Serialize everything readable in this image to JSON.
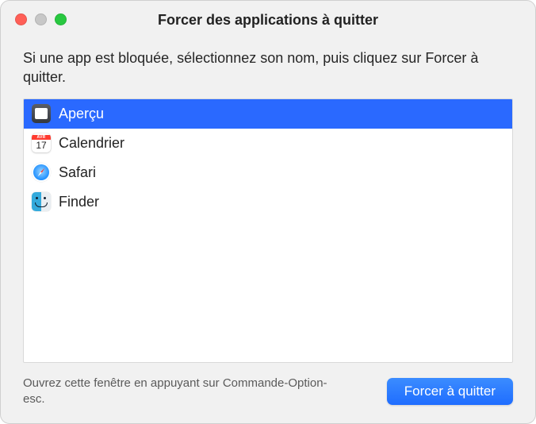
{
  "window": {
    "title": "Forcer des applications à quitter"
  },
  "instructions": "Si une app est bloquée, sélectionnez son nom, puis cliquez sur Forcer à quitter.",
  "apps": [
    {
      "name": "Aperçu",
      "icon": "preview",
      "selected": true
    },
    {
      "name": "Calendrier",
      "icon": "calendar",
      "selected": false
    },
    {
      "name": "Safari",
      "icon": "safari",
      "selected": false
    },
    {
      "name": "Finder",
      "icon": "finder",
      "selected": false
    }
  ],
  "calendar_icon": {
    "month": "AVR",
    "day": "17"
  },
  "footer": {
    "hint": "Ouvrez cette fenêtre en appuyant sur Commande-Option-esc.",
    "button": "Forcer à quitter"
  }
}
